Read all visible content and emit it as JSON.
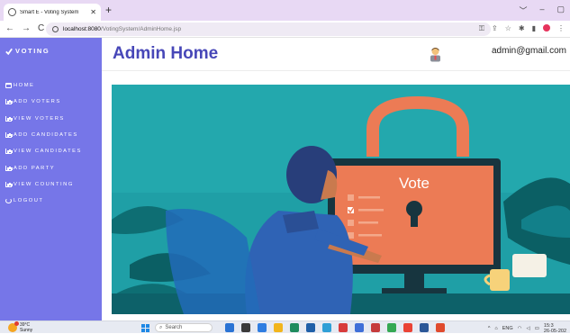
{
  "browser": {
    "tab_title": "Smart E - Voting System",
    "tab_close": "✕",
    "new_tab": "+",
    "url_host": "localhost:8080",
    "url_path": "/VotingSystem/AdminHome.jsp",
    "controls": {
      "minimize": "﹀",
      "restore": "–",
      "maximize": "▢",
      "close": "✕"
    }
  },
  "sidebar": {
    "brand": "VOTING",
    "items": [
      {
        "label": "HOME",
        "icon": "home-icon"
      },
      {
        "label": "ADD VOTERS",
        "icon": "chart-icon"
      },
      {
        "label": "VIEW VOTERS",
        "icon": "chart-icon"
      },
      {
        "label": "ADD CANDIDATES",
        "icon": "chart-icon"
      },
      {
        "label": "VIEW CANDIDATES",
        "icon": "chart-icon"
      },
      {
        "label": "ADD PARTY",
        "icon": "chart-icon"
      },
      {
        "label": "VIEW COUNTING",
        "icon": "chart-icon"
      },
      {
        "label": "LOGOUT",
        "icon": "logout-icon"
      }
    ]
  },
  "header": {
    "title": "Admin Home",
    "email": "admin@gmail.com"
  },
  "hero": {
    "screen_text": "Vote"
  },
  "taskbar": {
    "temperature": "39°C",
    "weather_text": "Sunny",
    "search_placeholder": "Search",
    "lang": "ENG",
    "time": "15:3",
    "date": "26-05-202"
  },
  "colors": {
    "sidebar_bg": "#7676e8",
    "title": "#4747b8",
    "hero_bg": "#1f9fa6",
    "orange": "#ec7b55"
  }
}
